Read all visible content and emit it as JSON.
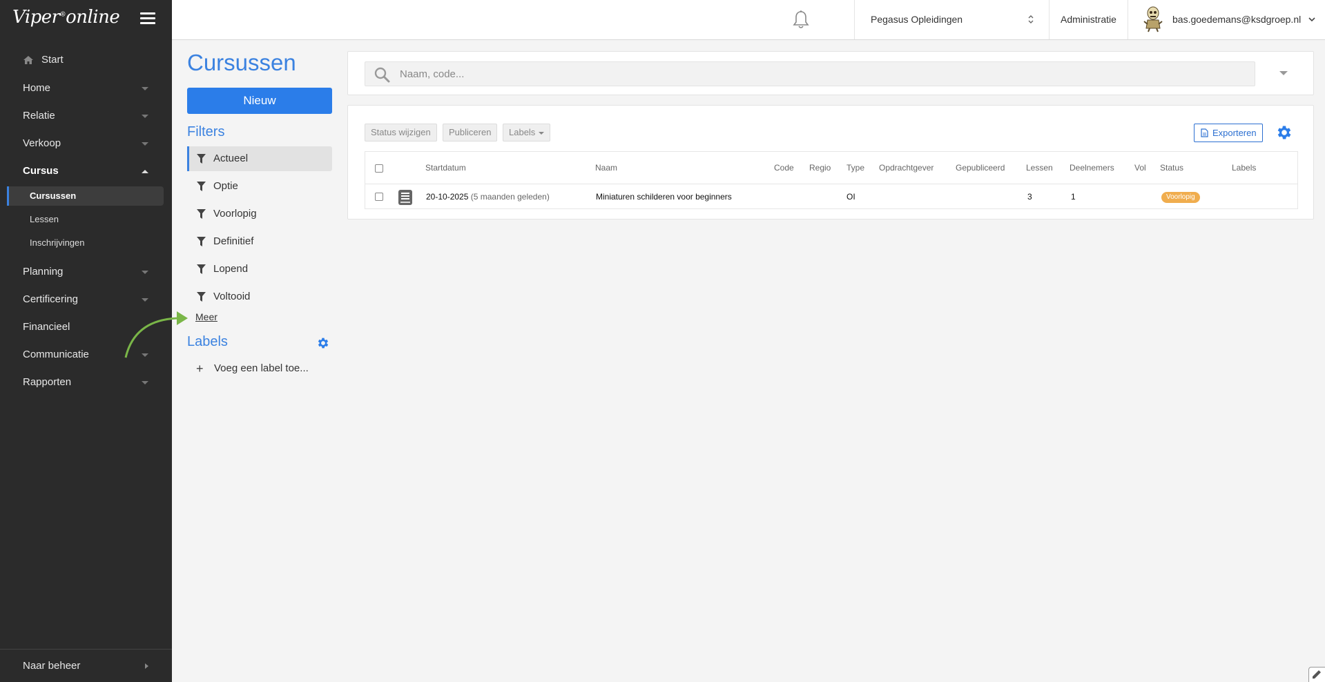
{
  "brand": {
    "name": "Viper",
    "mark": "®",
    "suffix": "online"
  },
  "sidebar": {
    "start": "Start",
    "items": [
      {
        "label": "Home"
      },
      {
        "label": "Relatie"
      },
      {
        "label": "Verkoop"
      },
      {
        "label": "Cursus"
      },
      {
        "label": "Planning"
      },
      {
        "label": "Certificering"
      },
      {
        "label": "Financieel"
      },
      {
        "label": "Communicatie"
      },
      {
        "label": "Rapporten"
      }
    ],
    "cursus_sub": [
      {
        "label": "Cursussen"
      },
      {
        "label": "Lessen"
      },
      {
        "label": "Inschrijvingen"
      }
    ],
    "bottom": "Naar beheer"
  },
  "topbar": {
    "organization": "Pegasus Opleidingen",
    "admin": "Administratie",
    "user": "bas.goedemans@ksdgroep.nl"
  },
  "left_panel": {
    "title": "Cursussen",
    "new_button": "Nieuw",
    "filters_title": "Filters",
    "filters": [
      "Actueel",
      "Optie",
      "Voorlopig",
      "Definitief",
      "Lopend",
      "Voltooid"
    ],
    "more": "Meer",
    "labels_title": "Labels",
    "add_label": "Voeg een label toe..."
  },
  "search": {
    "placeholder": "Naam, code..."
  },
  "toolbar": {
    "status": "Status wijzigen",
    "publish": "Publiceren",
    "labels": "Labels",
    "export": "Exporteren"
  },
  "table": {
    "headers": {
      "startdatum": "Startdatum",
      "naam": "Naam",
      "code": "Code",
      "regio": "Regio",
      "type": "Type",
      "opdrachtgever": "Opdrachtgever",
      "gepubliceerd": "Gepubliceerd",
      "lessen": "Lessen",
      "deelnemers": "Deelnemers",
      "vol": "Vol",
      "status": "Status",
      "labels": "Labels"
    },
    "rows": [
      {
        "startdatum": "20-10-2025",
        "relative": "(5 maanden geleden)",
        "naam": "Miniaturen schilderen voor beginners",
        "type": "OI",
        "lessen": "3",
        "deelnemers": "1",
        "status": "Voorlopig"
      }
    ]
  },
  "colors": {
    "accent": "#3b82e0",
    "primary_button": "#2b7de9",
    "sidebar": "#2b2b2b",
    "badge": "#f0ad4e",
    "annotation": "#7ab648"
  }
}
